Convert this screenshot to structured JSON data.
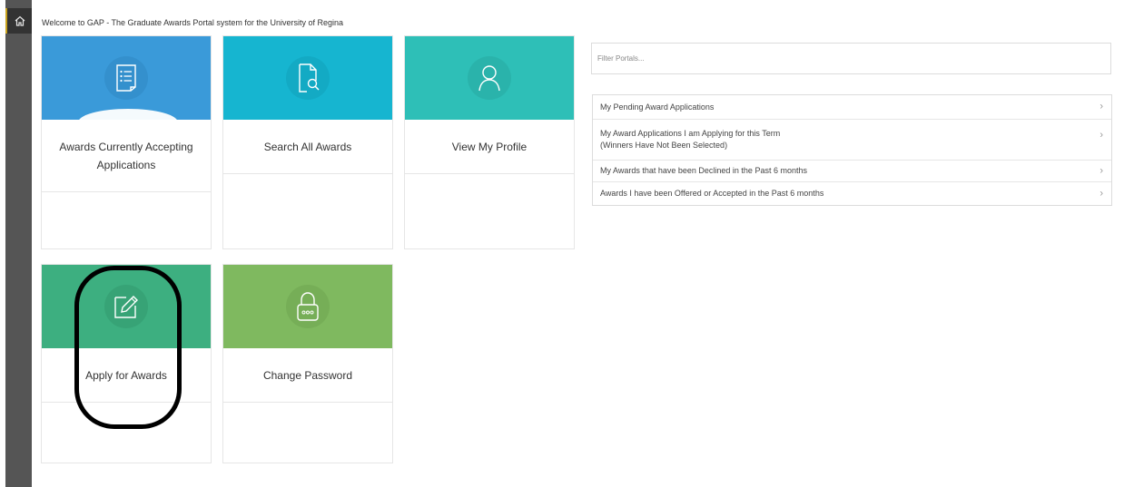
{
  "welcome_text": "Welcome to GAP - The Graduate Awards Portal system for the University of Regina",
  "sidebar": {
    "home_icon": "home-icon",
    "accent_color": "#c8a21c"
  },
  "cards": [
    {
      "label": "Awards Currently Accepting Applications",
      "icon": "list-document-icon",
      "color": "#3a9ad9"
    },
    {
      "label": "Search All Awards",
      "icon": "document-search-icon",
      "color": "#16b5d0"
    },
    {
      "label": "View My Profile",
      "icon": "user-icon",
      "color": "#2ebfb7"
    },
    {
      "label": "Apply for Awards",
      "icon": "pencil-edit-icon",
      "color": "#3daf80"
    },
    {
      "label": "Change Password",
      "icon": "lock-icon",
      "color": "#7fb95f"
    }
  ],
  "filter": {
    "placeholder": "Filter Portals..."
  },
  "portals": [
    {
      "line1": "My Pending Award Applications",
      "line2": ""
    },
    {
      "line1": "My Award Applications I am Applying for this Term",
      "line2": "(Winners Have Not Been Selected)"
    },
    {
      "line1": "My Awards that have been Declined in the Past 6 months",
      "line2": ""
    },
    {
      "line1": "Awards I have been Offered or Accepted in the Past 6 months",
      "line2": ""
    }
  ],
  "chevron": "›"
}
